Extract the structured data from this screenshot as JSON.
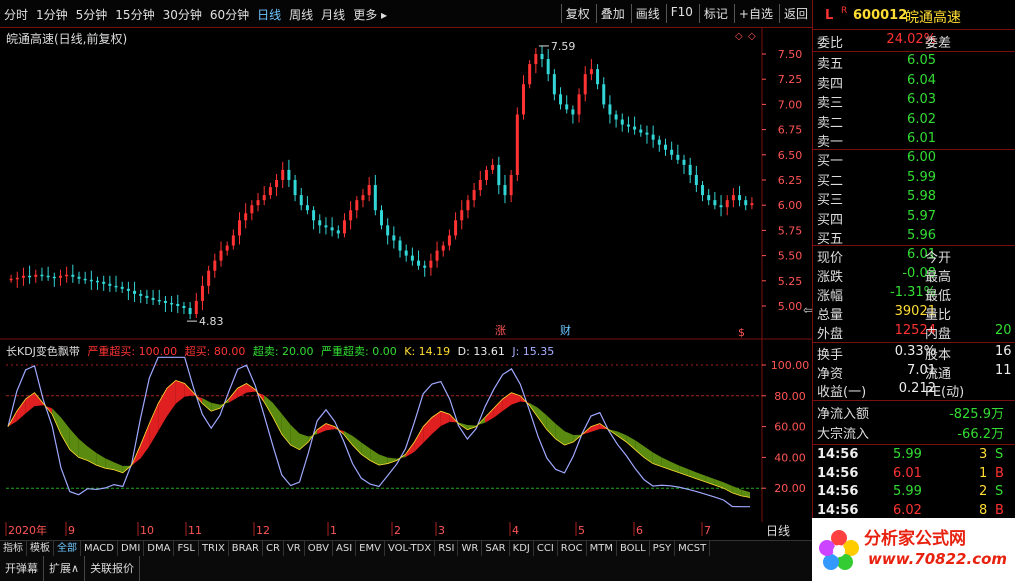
{
  "toolbar": {
    "periods": [
      "分时",
      "1分钟",
      "5分钟",
      "15分钟",
      "30分钟",
      "60分钟",
      "日线",
      "周线",
      "月线",
      "更多 ▸"
    ],
    "active_period": "日线",
    "actions": [
      "复权",
      "叠加",
      "画线",
      "F10",
      "标记",
      "+自选",
      "返回"
    ]
  },
  "main_chart": {
    "title": "皖通高速(日线,前复权)",
    "high_label": "7.59",
    "low_label": "4.83",
    "y_ticks": [
      "7.50",
      "7.25",
      "7.00",
      "6.75",
      "6.50",
      "6.25",
      "6.00",
      "5.75",
      "5.50",
      "5.25",
      "5.00"
    ],
    "markers": [
      "涨",
      "财",
      "$"
    ]
  },
  "kdj": {
    "name": "长KDJ变色飘带",
    "items": [
      {
        "label": "严重超买: 100.00",
        "color": "#ff3333"
      },
      {
        "label": "超买: 80.00",
        "color": "#ff3333"
      },
      {
        "label": "超卖: 20.00",
        "color": "#33dd33"
      },
      {
        "label": "严重超卖: 0.00",
        "color": "#33dd33"
      },
      {
        "label": "K: 14.19",
        "color": "#ffdd33"
      },
      {
        "label": "D: 13.61",
        "color": "#eeeeee"
      },
      {
        "label": "J: 15.35",
        "color": "#aab0ff"
      }
    ],
    "y_ticks": [
      "100.00",
      "80.00",
      "60.00",
      "40.00",
      "20.00"
    ]
  },
  "date_axis": {
    "labels": [
      "2020年",
      "9",
      "10",
      "11",
      "12",
      "1",
      "2",
      "3",
      "4",
      "5",
      "6",
      "7"
    ],
    "period_label": "日线"
  },
  "panel": {
    "stock_code": "600012",
    "stock_name": "皖通高速",
    "badge_l": "L",
    "badge_r": "R",
    "weibi_label": "委比",
    "weibi_value": "24.02%",
    "weicha_label": "委差",
    "asks": [
      {
        "label": "卖五",
        "price": "6.05"
      },
      {
        "label": "卖四",
        "price": "6.04"
      },
      {
        "label": "卖三",
        "price": "6.03"
      },
      {
        "label": "卖二",
        "price": "6.02"
      },
      {
        "label": "卖一",
        "price": "6.01"
      }
    ],
    "bids": [
      {
        "label": "买一",
        "price": "6.00"
      },
      {
        "label": "买二",
        "price": "5.99"
      },
      {
        "label": "买三",
        "price": "5.98"
      },
      {
        "label": "买四",
        "price": "5.97"
      },
      {
        "label": "买五",
        "price": "5.96"
      }
    ],
    "quote": [
      {
        "label": "现价",
        "value": "6.01",
        "color": "green",
        "label2": "今开",
        "value2": ""
      },
      {
        "label": "涨跌",
        "value": "-0.08",
        "color": "green",
        "label2": "最高",
        "value2": ""
      },
      {
        "label": "涨幅",
        "value": "-1.31%",
        "color": "green",
        "label2": "最低",
        "value2": ""
      },
      {
        "label": "总量",
        "value": "39021",
        "color": "yellow",
        "label2": "量比",
        "value2": ""
      },
      {
        "label": "外盘",
        "value": "12524",
        "color": "red",
        "label2": "内盘",
        "value2": "20"
      }
    ],
    "fundamentals": [
      {
        "label": "换手",
        "value": "0.33%",
        "label2": "股本",
        "value2": "16"
      },
      {
        "label": "净资",
        "value": "7.01",
        "label2": "流通",
        "value2": "11"
      },
      {
        "label": "收益(一)",
        "value": "0.212",
        "label2": "PE(动)",
        "value2": ""
      }
    ],
    "flows": [
      {
        "label": "净流入额",
        "value": "-825.9万"
      },
      {
        "label": "大宗流入",
        "value": "-66.2万"
      }
    ],
    "ticks": [
      {
        "time": "14:56",
        "price": "5.99",
        "vol": "3",
        "side": "S",
        "side_color": "green"
      },
      {
        "time": "14:56",
        "price": "6.01",
        "vol": "1",
        "side": "B",
        "side_color": "red"
      },
      {
        "time": "14:56",
        "price": "5.99",
        "vol": "2",
        "side": "S",
        "side_color": "green"
      },
      {
        "time": "14:56",
        "price": "6.02",
        "vol": "8",
        "side": "B",
        "side_color": "red"
      }
    ]
  },
  "indicator_tabs": [
    "指标",
    "模板",
    "全部",
    "MACD",
    "DMI",
    "DMA",
    "FSL",
    "TRIX",
    "BRAR",
    "CR",
    "VR",
    "OBV",
    "ASI",
    "EMV",
    "VOL-TDX",
    "RSI",
    "WR",
    "SAR",
    "KDJ",
    "CCI",
    "ROC",
    "MTM",
    "BOLL",
    "PSY",
    "MCST"
  ],
  "active_indicator_tab": "全部",
  "bottom_buttons": [
    "开弹幕",
    "扩展∧",
    "关联报价"
  ],
  "logo": {
    "name": "分析家公式网",
    "site": "www.70822.com"
  },
  "colors": {
    "up": "#ff3333",
    "down": "#33d6d6",
    "frame": "#7a1010",
    "k_band_up": "#e02020",
    "k_band_down": "#5a8a10",
    "j_line": "#9fa8ff"
  }
}
